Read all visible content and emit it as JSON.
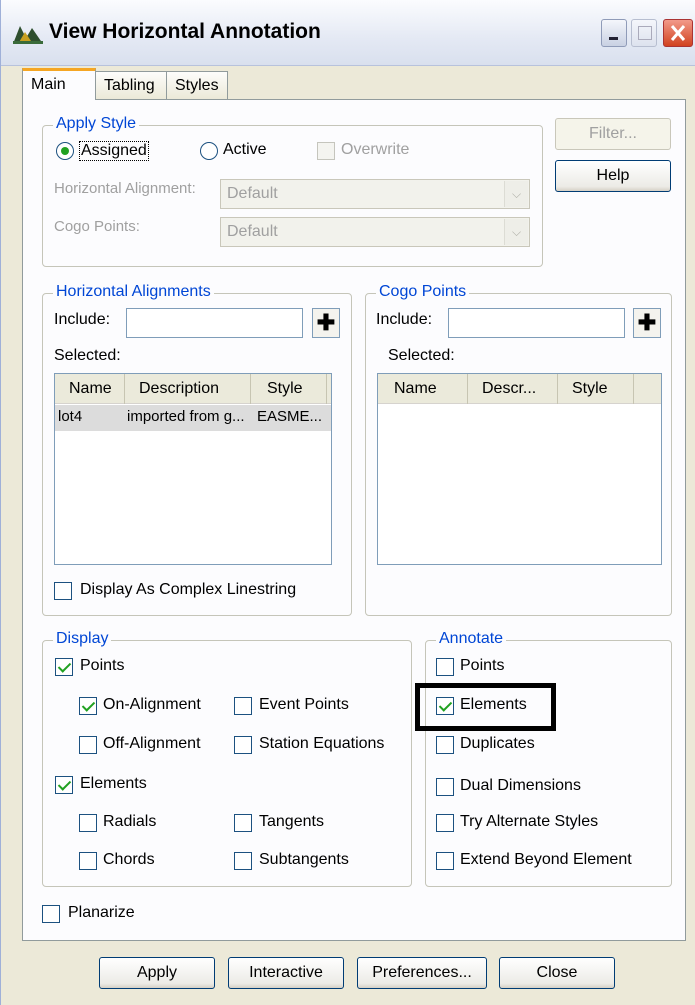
{
  "window": {
    "title": "View Horizontal Annotation"
  },
  "tabs": [
    "Main",
    "Tabling",
    "Styles"
  ],
  "apply_style": {
    "legend": "Apply Style",
    "assigned_label": "Assigned",
    "active_label": "Active",
    "overwrite_label": "Overwrite",
    "selected_option": "Assigned",
    "horizontal_alignment_label": "Horizontal Alignment:",
    "horizontal_alignment_value": "Default",
    "cogo_points_label": "Cogo Points:",
    "cogo_points_value": "Default"
  },
  "side_buttons": {
    "filter": "Filter...",
    "help": "Help"
  },
  "horizontal_alignments": {
    "legend": "Horizontal Alignments",
    "include_label": "Include:",
    "include_value": "",
    "selected_label": "Selected:",
    "columns": [
      "Name",
      "Description",
      "Style"
    ],
    "rows": [
      {
        "name": "lot4",
        "description": "imported from g...",
        "style": "EASME..."
      }
    ],
    "complex_label": "Display As Complex Linestring"
  },
  "cogo_points": {
    "legend": "Cogo Points",
    "include_label": "Include:",
    "include_value": "",
    "selected_label": "Selected:",
    "columns": [
      "Name",
      "Descr...",
      "Style"
    ]
  },
  "display": {
    "legend": "Display",
    "points": "Points",
    "on_alignment": "On-Alignment",
    "event_points": "Event Points",
    "off_alignment": "Off-Alignment",
    "station_equations": "Station Equations",
    "elements": "Elements",
    "radials": "Radials",
    "tangents": "Tangents",
    "chords": "Chords",
    "subtangents": "Subtangents"
  },
  "annotate": {
    "legend": "Annotate",
    "points": "Points",
    "elements": "Elements",
    "duplicates": "Duplicates",
    "dual_dimensions": "Dual Dimensions",
    "try_alternate_styles": "Try Alternate Styles",
    "extend_beyond_element": "Extend Beyond Element"
  },
  "planarize": "Planarize",
  "bottom_buttons": {
    "apply": "Apply",
    "interactive": "Interactive",
    "preferences": "Preferences...",
    "close": "Close"
  }
}
